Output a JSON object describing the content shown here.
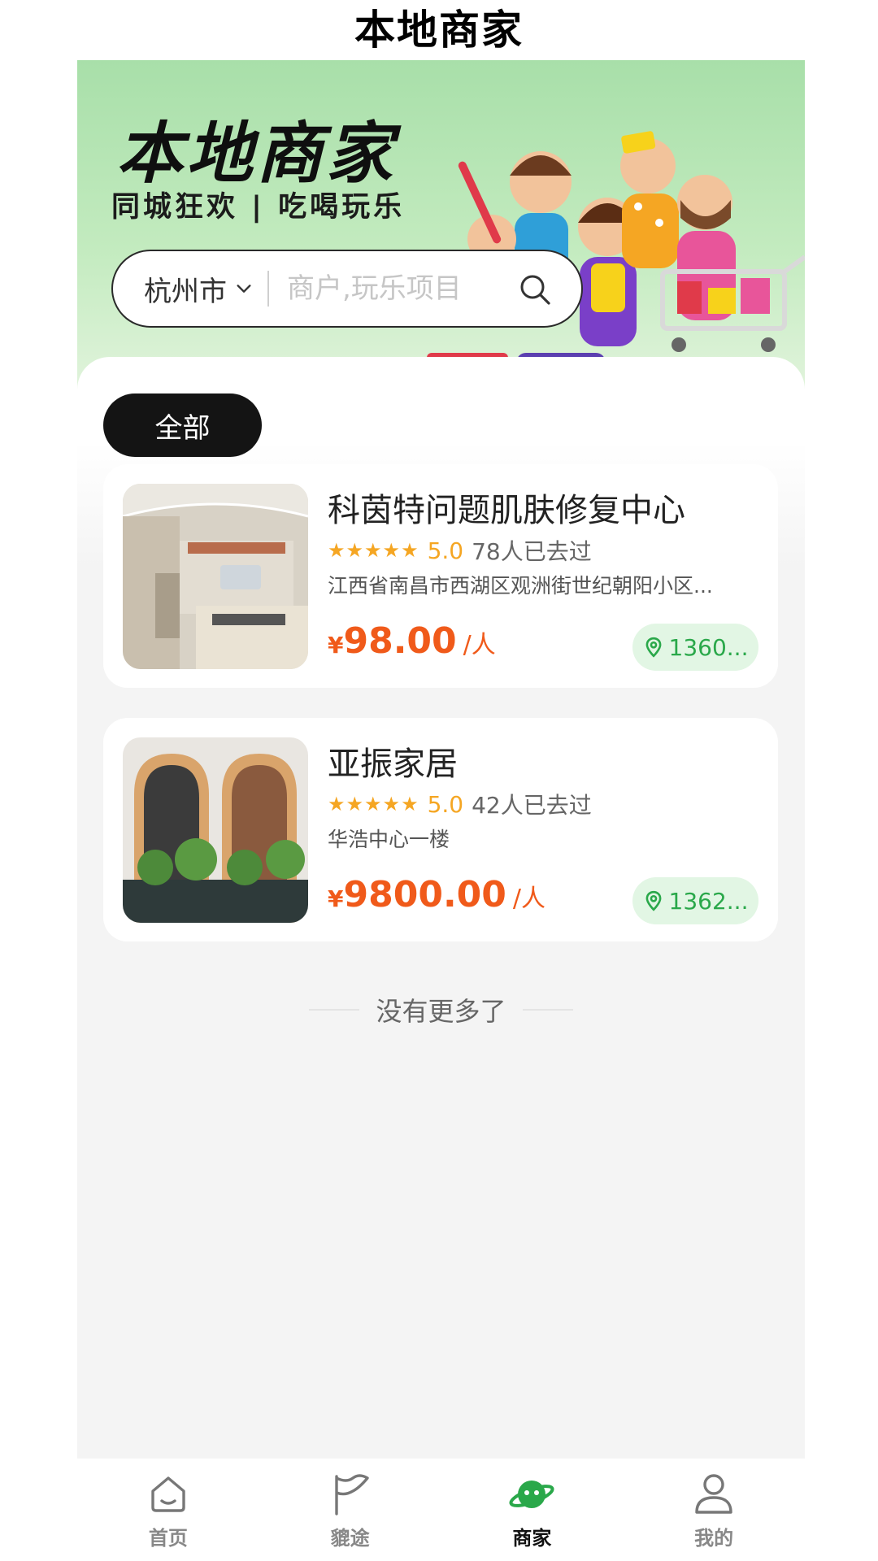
{
  "page": {
    "title": "本地商家"
  },
  "banner": {
    "title": "本地商家",
    "subtitle": "同城狂欢 | 吃喝玩乐"
  },
  "search": {
    "city": "杭州市",
    "placeholder": "商户,玩乐项目",
    "icon": "search-icon"
  },
  "filter": {
    "active_chip": "全部"
  },
  "merchants": [
    {
      "name": "科茵特问题肌肤修复中心",
      "stars": "★★★★★",
      "score": "5.0",
      "visits": "78人已去过",
      "address": "江西省南昌市西湖区观洲街世纪朝阳小区...",
      "currency": "¥",
      "price": "98.00",
      "unit": "/人",
      "distance": "1360..."
    },
    {
      "name": "亚振家居",
      "stars": "★★★★★",
      "score": "5.0",
      "visits": "42人已去过",
      "address": "华浩中心一楼",
      "currency": "¥",
      "price": "9800.00",
      "unit": "/人",
      "distance": "1362..."
    }
  ],
  "end_note": "没有更多了",
  "tabbar": [
    {
      "label": "首页",
      "icon": "home-icon",
      "active": false
    },
    {
      "label": "貔途",
      "icon": "flag-icon",
      "active": false
    },
    {
      "label": "商家",
      "icon": "planet-icon",
      "active": true
    },
    {
      "label": "我的",
      "icon": "user-icon",
      "active": false
    }
  ],
  "colors": {
    "accent_green": "#2aa84a",
    "price_orange": "#f05a1a",
    "star_gold": "#f5a623",
    "banner_green": "#a8dfa9"
  }
}
